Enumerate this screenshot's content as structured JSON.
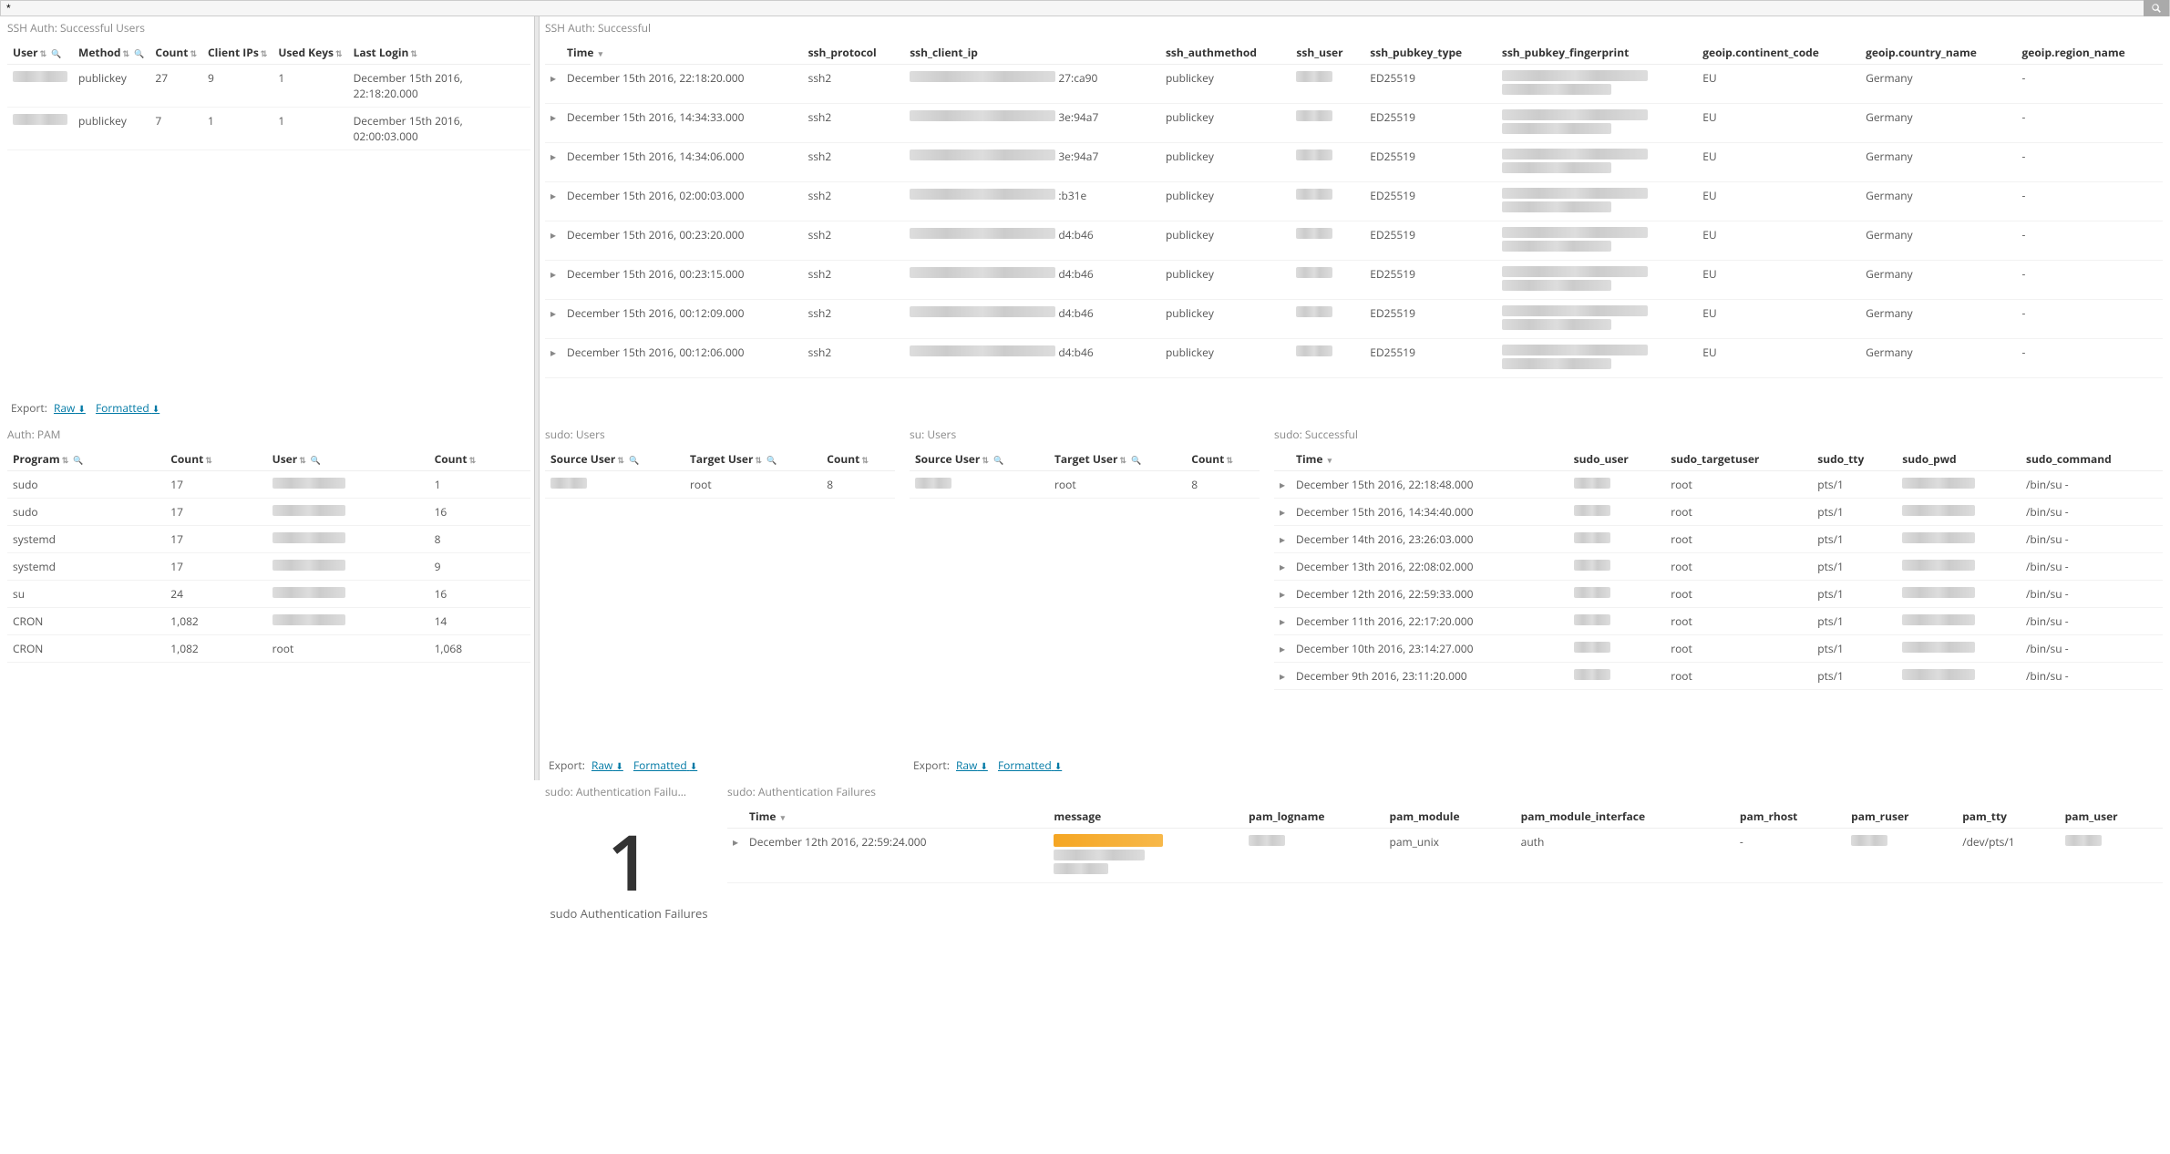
{
  "topbar": {
    "query": "*"
  },
  "panels": {
    "ssh_users": {
      "title": "SSH Auth: Successful Users",
      "columns": [
        "User",
        "Method",
        "Count",
        "Client IPs",
        "Used Keys",
        "Last Login"
      ],
      "rows": [
        {
          "user": "████",
          "method": "publickey",
          "count": "27",
          "ips": "9",
          "keys": "1",
          "last": "December 15th 2016, 22:18:20.000"
        },
        {
          "user": "█████████",
          "method": "publickey",
          "count": "7",
          "ips": "1",
          "keys": "1",
          "last": "December 15th 2016, 02:00:03.000"
        }
      ],
      "export": {
        "label": "Export:",
        "raw": "Raw",
        "formatted": "Formatted"
      }
    },
    "ssh_success": {
      "title": "SSH Auth: Successful",
      "columns": [
        "Time",
        "ssh_protocol",
        "ssh_client_ip",
        "ssh_authmethod",
        "ssh_user",
        "ssh_pubkey_type",
        "ssh_pubkey_fingerprint",
        "geoip.continent_code",
        "geoip.country_name",
        "geoip.region_name"
      ],
      "rows": [
        {
          "time": "December 15th 2016, 22:18:20.000",
          "proto": "ssh2",
          "ip_suffix": "27:ca90",
          "auth": "publickey",
          "user": "████",
          "pktype": "ED25519",
          "cc": "EU",
          "country": "Germany",
          "region": "-"
        },
        {
          "time": "December 15th 2016, 14:34:33.000",
          "proto": "ssh2",
          "ip_suffix": "3e:94a7",
          "auth": "publickey",
          "user": "████",
          "pktype": "ED25519",
          "cc": "EU",
          "country": "Germany",
          "region": "-"
        },
        {
          "time": "December 15th 2016, 14:34:06.000",
          "proto": "ssh2",
          "ip_suffix": "3e:94a7",
          "auth": "publickey",
          "user": "████",
          "pktype": "ED25519",
          "cc": "EU",
          "country": "Germany",
          "region": "-"
        },
        {
          "time": "December 15th 2016, 02:00:03.000",
          "proto": "ssh2",
          "ip_suffix": ":b31e",
          "auth": "publickey",
          "user": "██████████",
          "pktype": "ED25519",
          "cc": "EU",
          "country": "Germany",
          "region": "-"
        },
        {
          "time": "December 15th 2016, 00:23:20.000",
          "proto": "ssh2",
          "ip_suffix": "d4:b46",
          "auth": "publickey",
          "user": "████",
          "pktype": "ED25519",
          "cc": "EU",
          "country": "Germany",
          "region": "-"
        },
        {
          "time": "December 15th 2016, 00:23:15.000",
          "proto": "ssh2",
          "ip_suffix": "d4:b46",
          "auth": "publickey",
          "user": "████",
          "pktype": "ED25519",
          "cc": "EU",
          "country": "Germany",
          "region": "-"
        },
        {
          "time": "December 15th 2016, 00:12:09.000",
          "proto": "ssh2",
          "ip_suffix": "d4:b46",
          "auth": "publickey",
          "user": "████",
          "pktype": "ED25519",
          "cc": "EU",
          "country": "Germany",
          "region": "-"
        },
        {
          "time": "December 15th 2016, 00:12:06.000",
          "proto": "ssh2",
          "ip_suffix": "d4:b46",
          "auth": "publickey",
          "user": "████",
          "pktype": "ED25519",
          "cc": "EU",
          "country": "Germany",
          "region": "-"
        }
      ]
    },
    "auth_pam": {
      "title": "Auth: PAM",
      "columns": [
        "Program",
        "Count",
        "User",
        "Count"
      ],
      "rows": [
        {
          "program": "sudo",
          "c1": "17",
          "user": "██████",
          "c2": "1"
        },
        {
          "program": "sudo",
          "c1": "17",
          "user": "████",
          "c2": "16"
        },
        {
          "program": "systemd",
          "c1": "17",
          "user": "██████████",
          "c2": "8"
        },
        {
          "program": "systemd",
          "c1": "17",
          "user": "████",
          "c2": "9"
        },
        {
          "program": "su",
          "c1": "24",
          "user": "████",
          "c2": "16"
        },
        {
          "program": "CRON",
          "c1": "1,082",
          "user": "████████",
          "c2": "14"
        },
        {
          "program": "CRON",
          "c1": "1,082",
          "user": "root",
          "c2": "1,068"
        }
      ]
    },
    "sudo_users": {
      "title": "sudo: Users",
      "columns": [
        "Source User",
        "Target User",
        "Count"
      ],
      "rows": [
        {
          "src": "████",
          "tgt": "root",
          "cnt": "8"
        }
      ],
      "export": {
        "label": "Export:",
        "raw": "Raw",
        "formatted": "Formatted"
      }
    },
    "su_users": {
      "title": "su: Users",
      "columns": [
        "Source User",
        "Target User",
        "Count"
      ],
      "rows": [
        {
          "src": "████",
          "tgt": "root",
          "cnt": "8"
        }
      ],
      "export": {
        "label": "Export:",
        "raw": "Raw",
        "formatted": "Formatted"
      }
    },
    "sudo_success": {
      "title": "sudo: Successful",
      "columns": [
        "Time",
        "sudo_user",
        "sudo_targetuser",
        "sudo_tty",
        "sudo_pwd",
        "sudo_command"
      ],
      "rows": [
        {
          "time": "December 15th 2016, 22:18:48.000",
          "user": "████",
          "tuser": "root",
          "tty": "pts/1",
          "pwd": "██████████",
          "cmd": "/bin/su -"
        },
        {
          "time": "December 15th 2016, 14:34:40.000",
          "user": "████",
          "tuser": "root",
          "tty": "pts/1",
          "pwd": "██████████",
          "cmd": "/bin/su -"
        },
        {
          "time": "December 14th 2016, 23:26:03.000",
          "user": "████",
          "tuser": "root",
          "tty": "pts/1",
          "pwd": "██████████",
          "cmd": "/bin/su -"
        },
        {
          "time": "December 13th 2016, 22:08:02.000",
          "user": "████",
          "tuser": "root",
          "tty": "pts/1",
          "pwd": "██████████",
          "cmd": "/bin/su -"
        },
        {
          "time": "December 12th 2016, 22:59:33.000",
          "user": "████",
          "tuser": "root",
          "tty": "pts/1",
          "pwd": "██████████",
          "cmd": "/bin/su -"
        },
        {
          "time": "December 11th 2016, 22:17:20.000",
          "user": "████",
          "tuser": "root",
          "tty": "pts/1",
          "pwd": "██████████",
          "cmd": "/bin/su -"
        },
        {
          "time": "December 10th 2016, 23:14:27.000",
          "user": "████",
          "tuser": "root",
          "tty": "pts/1",
          "pwd": "██████████",
          "cmd": "/bin/su -"
        },
        {
          "time": "December 9th 2016, 23:11:20.000",
          "user": "████",
          "tuser": "root",
          "tty": "pts/1",
          "pwd": "██████████",
          "cmd": "/bin/su -"
        }
      ]
    },
    "sudo_fail_count": {
      "title": "sudo: Authentication Failu...",
      "value": "1",
      "label": "sudo Authentication Failures"
    },
    "sudo_fail_list": {
      "title": "sudo: Authentication Failures",
      "columns": [
        "Time",
        "message",
        "pam_logname",
        "pam_module",
        "pam_module_interface",
        "pam_rhost",
        "pam_ruser",
        "pam_tty",
        "pam_user"
      ],
      "rows": [
        {
          "time": "December 12th 2016, 22:59:24.000",
          "logname": "████",
          "module": "pam_unix",
          "iface": "auth",
          "rhost": "-",
          "ruser": "████",
          "tty": "/dev/pts/1",
          "user": "████"
        }
      ]
    }
  }
}
